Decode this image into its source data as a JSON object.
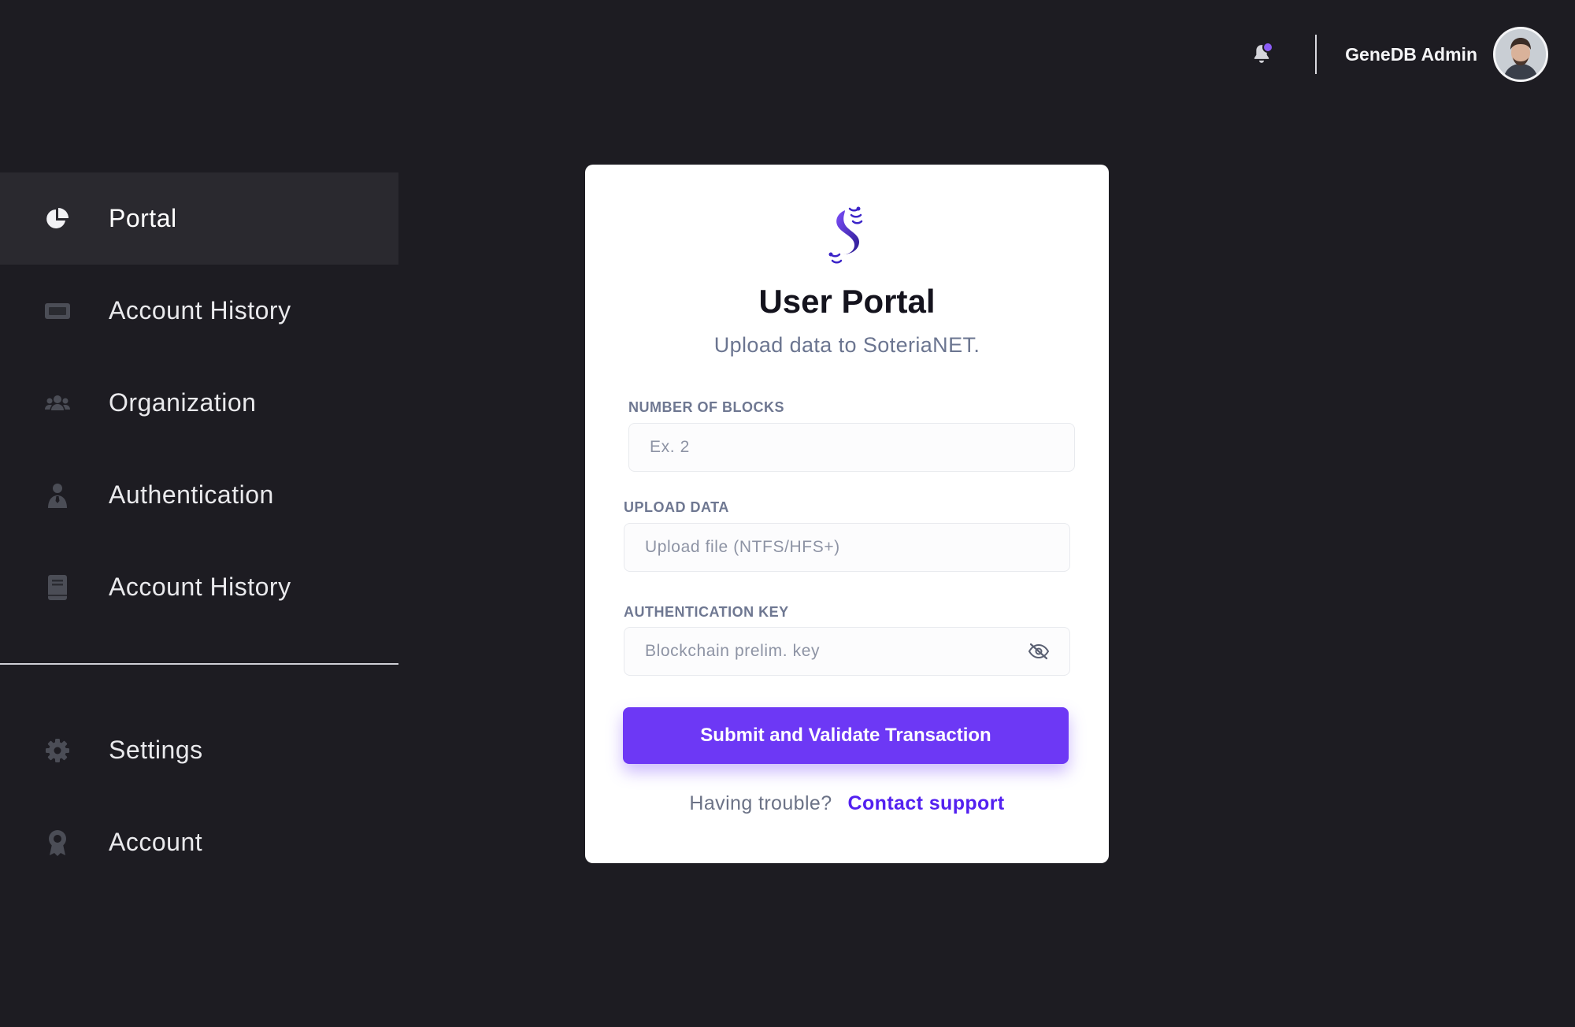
{
  "header": {
    "user_name": "GeneDB Admin",
    "accent_color": "#8b5cf6"
  },
  "sidebar": {
    "items": [
      {
        "label": "Portal",
        "icon": "pie-chart-icon",
        "active": true
      },
      {
        "label": "Account History",
        "icon": "ticket-icon"
      },
      {
        "label": "Organization",
        "icon": "users-icon"
      },
      {
        "label": "Authentication",
        "icon": "person-badge-icon"
      },
      {
        "label": "Account History",
        "icon": "book-icon"
      }
    ],
    "bottom_items": [
      {
        "label": "Settings",
        "icon": "gear-icon"
      },
      {
        "label": "Account",
        "icon": "award-icon"
      }
    ]
  },
  "card": {
    "title": "User Portal",
    "subtitle": "Upload data to SoteriaNET.",
    "fields": {
      "blocks": {
        "label": "NUMBER OF BLOCKS",
        "placeholder": "Ex. 2",
        "value": ""
      },
      "upload": {
        "label": "UPLOAD DATA",
        "placeholder": "Upload file (NTFS/HFS+)",
        "value": ""
      },
      "auth_key": {
        "label": "AUTHENTICATION KEY",
        "placeholder": "Blockchain prelim. key",
        "value": ""
      }
    },
    "submit_label": "Submit and Validate Transaction",
    "help_text": "Having trouble?",
    "help_link": "Contact support",
    "brand_color": "#6d38f5"
  }
}
